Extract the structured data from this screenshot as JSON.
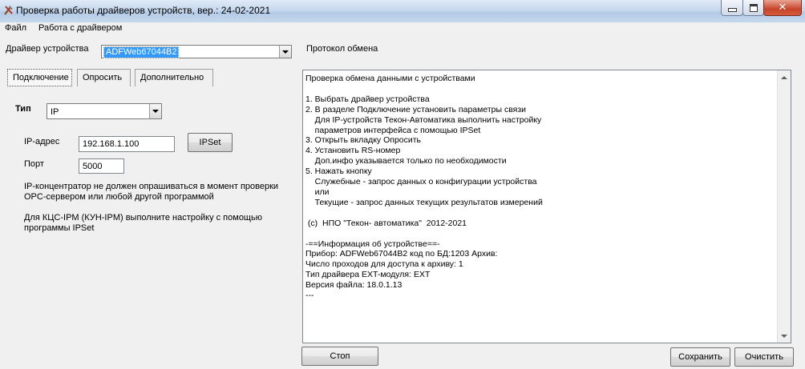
{
  "window": {
    "title": "Проверка работы драйверов устройств, вер.: 24-02-2021"
  },
  "menu": [
    "Файл",
    "Работа с драйвером"
  ],
  "driver": {
    "label": "Драйвер устройства",
    "selected": "ADFWeb67044B2"
  },
  "protocol_label": "Протокол обмена",
  "tabs": [
    "Подключение",
    "Опросить",
    "Дополнительно"
  ],
  "connection": {
    "type_label": "Тип",
    "type_value": "IP",
    "ip_label": "IP-адрес",
    "ip_value": "192.168.1.100",
    "ipset_button": "IPSet",
    "port_label": "Порт",
    "port_value": "5000",
    "note1": "IP-концентратор не должен опрашиваться в момент проверки\nOPC-сервером или любой другой программой",
    "note2": "Для КЦС-IPM (КУН-IPM) выполните настройку с помощью\nпрограммы IPSet"
  },
  "log_text": "Проверка обмена данными с устройствами\n\n1. Выбрать драйвер устройства\n2. В разделе Подключение установить параметры связи\n    Для IP-устройств Текон-Автоматика выполнить настройку\n    параметров интерфейса с помощью IPSet\n3. Открыть вкладку Опросить\n4. Установить RS-номер\n    Доп.инфо указывается только по необходимости\n5. Нажать кнопку\n    Служебные - запрос данных о конфигурации устройства\n    или\n    Текущие - запрос данных текущих результатов измерений\n\n (c)  НПО \"Текон- автоматика\"  2012-2021\n\n-==Информация об устройстве==-\nПрибор: ADFWeb67044B2 код по БД:1203 Архив:\nЧисло проходов для доступа к архиву: 1\nТип драйвера EXT-модуля: EXT\nВерсия файла: 18.0.1.13\n---",
  "buttons": {
    "stop": "Стоп",
    "save": "Сохранить",
    "clear": "Очистить"
  }
}
